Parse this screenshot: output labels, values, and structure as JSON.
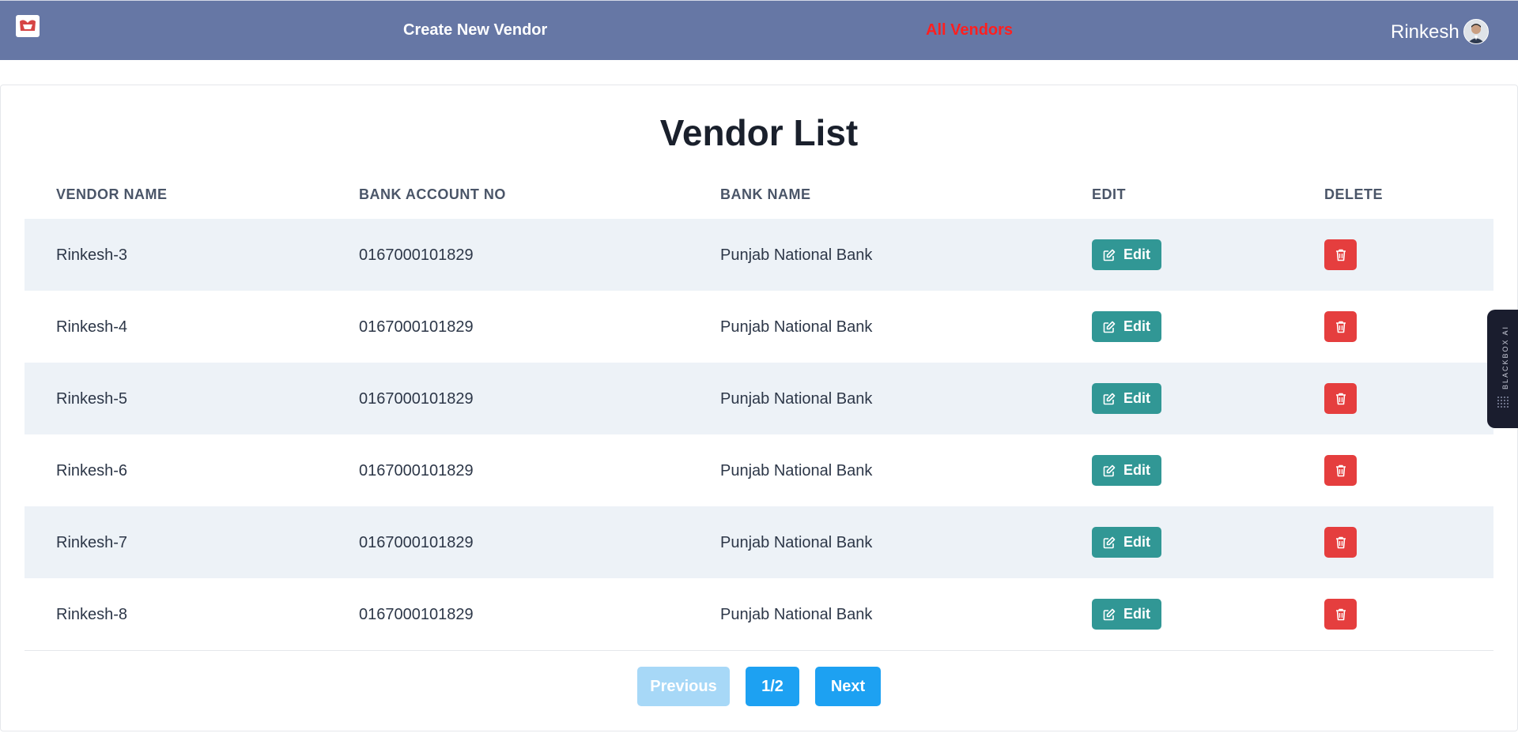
{
  "navbar": {
    "create_link": "Create New Vendor",
    "all_link": "All Vendors",
    "user_name": "Rinkesh",
    "bg_color": "#6677a5",
    "active_color": "#ff1f1f"
  },
  "page": {
    "title": "Vendor List"
  },
  "table": {
    "headers": [
      "VENDOR NAME",
      "BANK ACCOUNT NO",
      "BANK NAME",
      "EDIT",
      "DELETE"
    ],
    "rows": [
      {
        "vendor": "Rinkesh-3",
        "account": "0167000101829",
        "bank": "Punjab National Bank"
      },
      {
        "vendor": "Rinkesh-4",
        "account": "0167000101829",
        "bank": "Punjab National Bank"
      },
      {
        "vendor": "Rinkesh-5",
        "account": "0167000101829",
        "bank": "Punjab National Bank"
      },
      {
        "vendor": "Rinkesh-6",
        "account": "0167000101829",
        "bank": "Punjab National Bank"
      },
      {
        "vendor": "Rinkesh-7",
        "account": "0167000101829",
        "bank": "Punjab National Bank"
      },
      {
        "vendor": "Rinkesh-8",
        "account": "0167000101829",
        "bank": "Punjab National Bank"
      }
    ],
    "edit_label": "Edit",
    "edit_color": "#319795",
    "delete_color": "#e53e3e"
  },
  "pagination": {
    "previous": "Previous",
    "page": "1/2",
    "next": "Next"
  },
  "side_widget": {
    "label": "BLACKBOX AI"
  },
  "icons": {
    "logo": "vendor-logo-icon",
    "avatar": "user-avatar",
    "edit": "edit-icon",
    "delete": "trash-icon",
    "side": "dots-grid-icon"
  }
}
